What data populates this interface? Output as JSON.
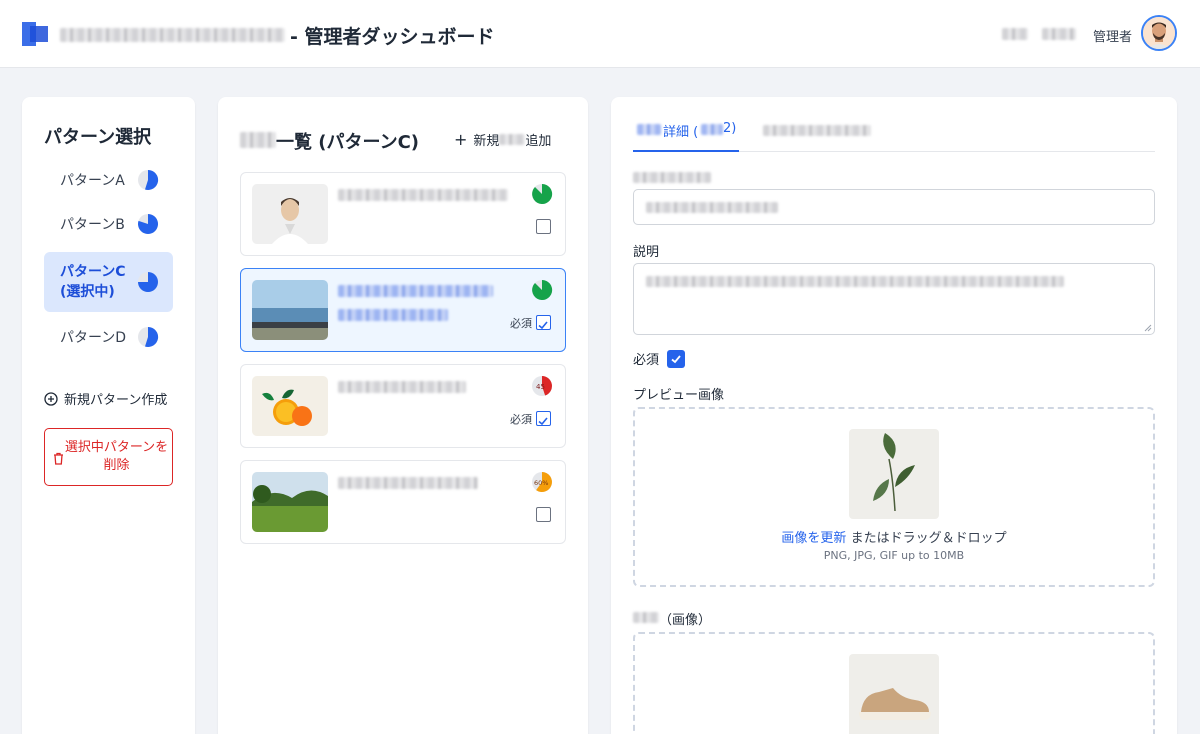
{
  "header": {
    "title_suffix": "- 管理者ダッシュボード",
    "role": "管理者"
  },
  "patterns": {
    "title": "パターン選択",
    "items": [
      {
        "label": "パターンA",
        "percent": 55
      },
      {
        "label": "パターンB",
        "percent": 80
      },
      {
        "label_line1": "パターンC",
        "label_line2": "(選択中)",
        "percent": 75
      },
      {
        "label": "パターンD",
        "percent": 55
      }
    ],
    "new_label": "新規パターン作成",
    "delete_label": "選択中パターンを削除"
  },
  "list": {
    "title": "一覧 (パターンC)",
    "add_prefix": "新規",
    "add_suffix": "追加",
    "cards": [
      {
        "thumb": "person-icon",
        "percent": 85,
        "percent_label": "",
        "required": false,
        "required_label": ""
      },
      {
        "thumb": "seaside-image",
        "percent": 85,
        "percent_label": "",
        "required": true,
        "required_label": "必須"
      },
      {
        "thumb": "orange-image",
        "percent": 45,
        "percent_label": "45",
        "required": true,
        "required_label": "必須"
      },
      {
        "thumb": "park-image",
        "percent": 60,
        "percent_label": "60%",
        "required": false,
        "required_label": ""
      }
    ]
  },
  "detail": {
    "tab_label": "詳細 (",
    "tab_label_end": "2)",
    "description_label": "説明",
    "required_label": "必須",
    "preview_label": "プレビュー画像",
    "upload_link": "画像を更新",
    "upload_text": " またはドラッグ＆ドロップ",
    "upload_hint": "PNG, JPG, GIF up to 10MB",
    "image_label": "（画像）"
  },
  "colors": {
    "primary": "#2563eb",
    "danger": "#dc2626",
    "success": "#16a34a",
    "warning": "#f59e0b"
  }
}
